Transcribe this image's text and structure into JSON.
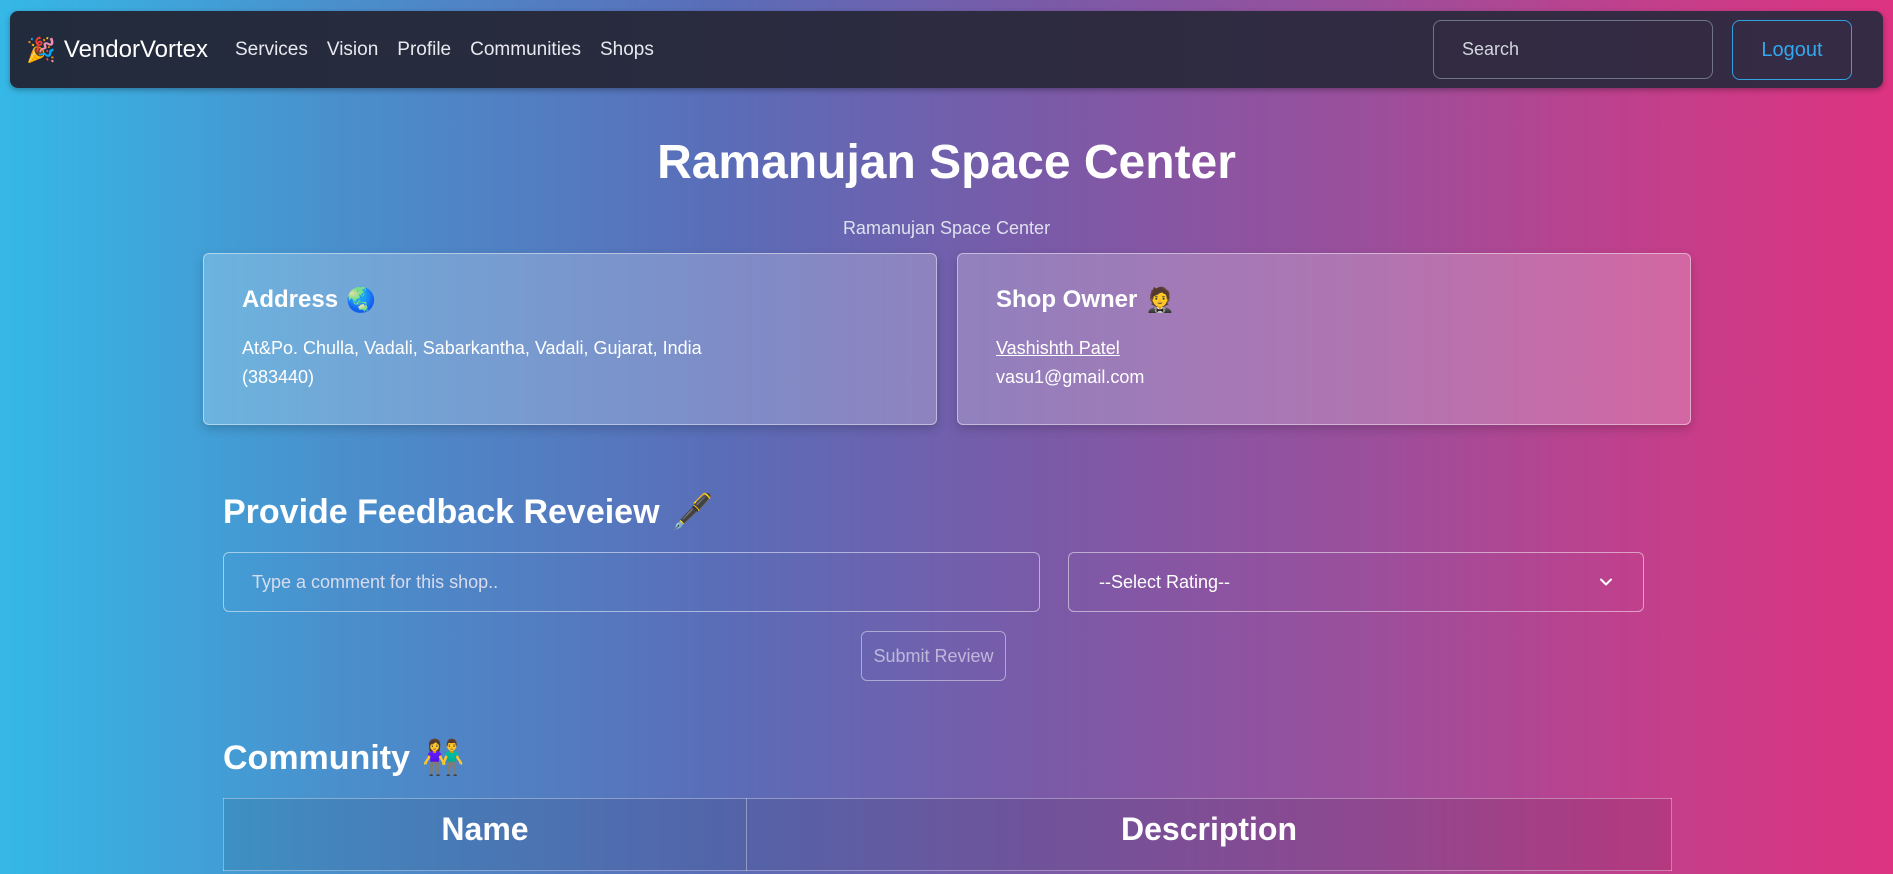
{
  "navbar": {
    "brand_icon": "🎉",
    "brand_name": "VendorVortex",
    "links": [
      "Services",
      "Vision",
      "Profile",
      "Communities",
      "Shops"
    ],
    "search_placeholder": "Search",
    "logout_label": "Logout"
  },
  "header": {
    "title": "Ramanujan Space Center",
    "subtitle": "Ramanujan Space Center"
  },
  "address_card": {
    "title": "Address",
    "icon": "🌏",
    "text": "At&Po. Chulla, Vadali, Sabarkantha, Vadali, Gujarat, India (383440)"
  },
  "owner_card": {
    "title": "Shop Owner",
    "icon": "🤵",
    "name": "Vashishth Patel",
    "email": "vasu1@gmail.com"
  },
  "feedback": {
    "title": "Provide Feedback Reveiew",
    "icon": "🖋️",
    "comment_placeholder": "Type a comment for this shop..",
    "rating_selected": "--Select Rating--",
    "submit_label": "Submit Review"
  },
  "community": {
    "title": "Community",
    "icon": "👫",
    "columns": [
      "Name",
      "Description"
    ]
  }
}
